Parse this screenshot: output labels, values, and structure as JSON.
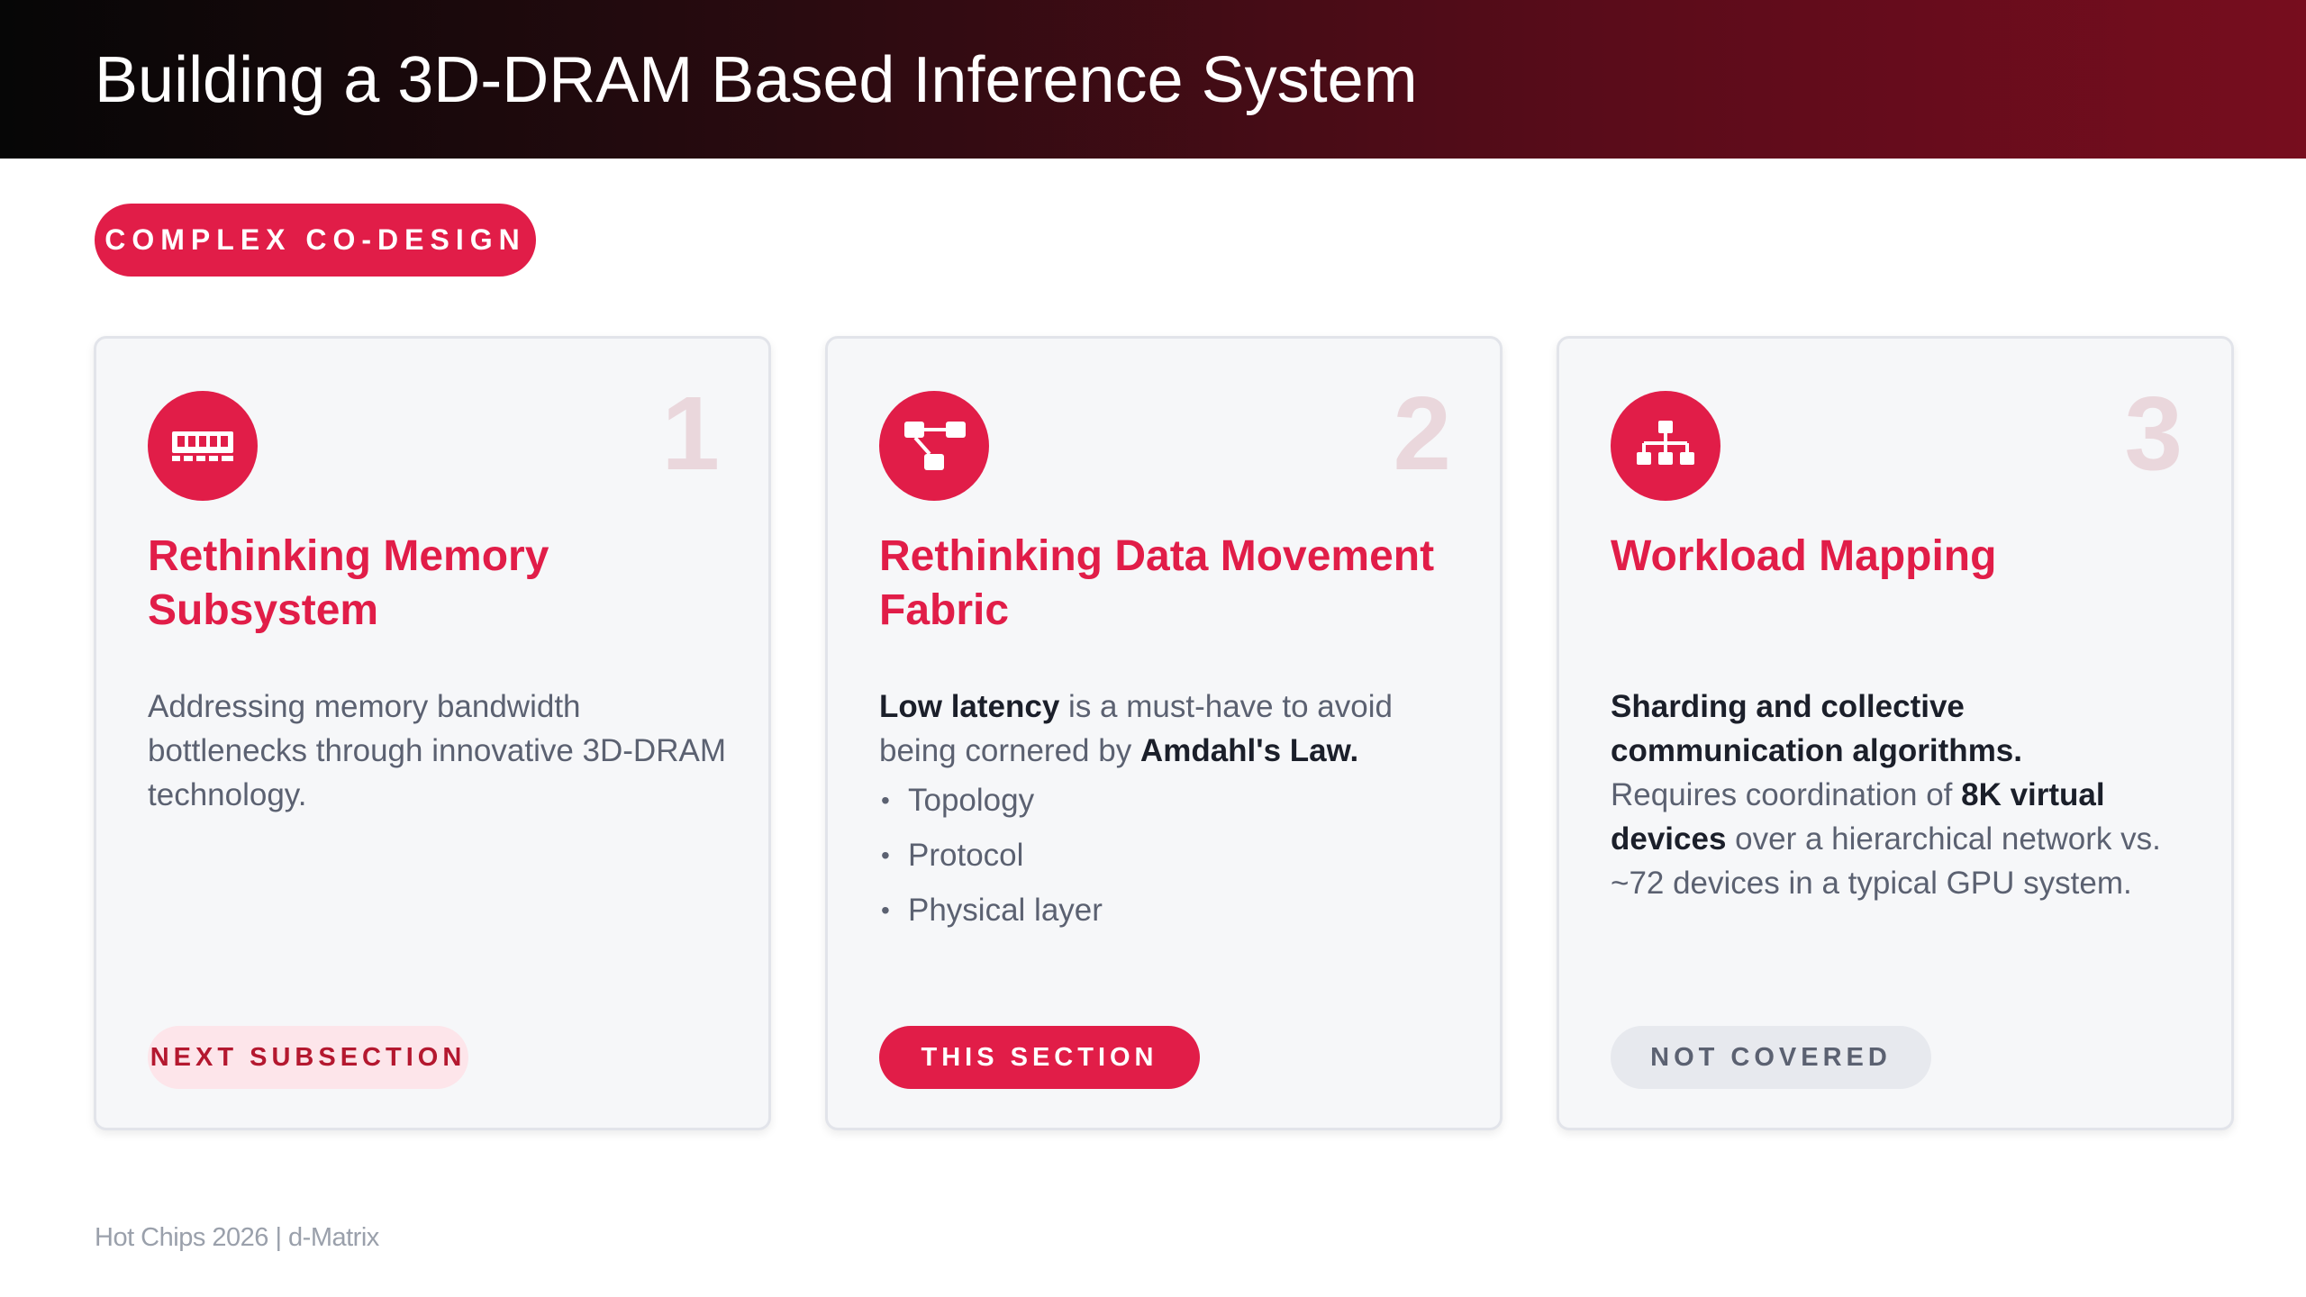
{
  "header": {
    "title": "Building a 3D-DRAM Based Inference System"
  },
  "tag": {
    "label": "COMPLEX CO-DESIGN"
  },
  "cards": [
    {
      "number": "1",
      "icon": "memory-chip-icon",
      "title": "Rethinking Memory Subsystem",
      "body": "Addressing memory bandwidth bottlenecks through innovative 3D-DRAM technology.",
      "status": "NEXT SUBSECTION"
    },
    {
      "number": "2",
      "icon": "data-flow-icon",
      "title": "Rethinking Data Movement Fabric",
      "body_strong_1": "Low latency",
      "body_text_1": " is a must-have to avoid being cornered by ",
      "body_strong_2": "Amdahl's Law.",
      "bullets": [
        "Topology",
        "Protocol",
        "Physical layer"
      ],
      "status": "THIS SECTION"
    },
    {
      "number": "3",
      "icon": "hierarchy-network-icon",
      "title": "Workload Mapping",
      "lead": "Sharding and collective communication algorithms.",
      "body_text_1": "Requires coordination of ",
      "body_strong_1": "8K virtual devices",
      "body_text_2": " over a hierarchical network vs. ~72 devices in a typical GPU system.",
      "status": "NOT COVERED"
    }
  ],
  "footer": {
    "text": "Hot Chips 2026  |  d-Matrix"
  },
  "colors": {
    "accent": "#e11d48",
    "number_tint": "#ead7dc",
    "card_bg": "#f6f7f9",
    "header_gradient_end": "#770d1e"
  }
}
